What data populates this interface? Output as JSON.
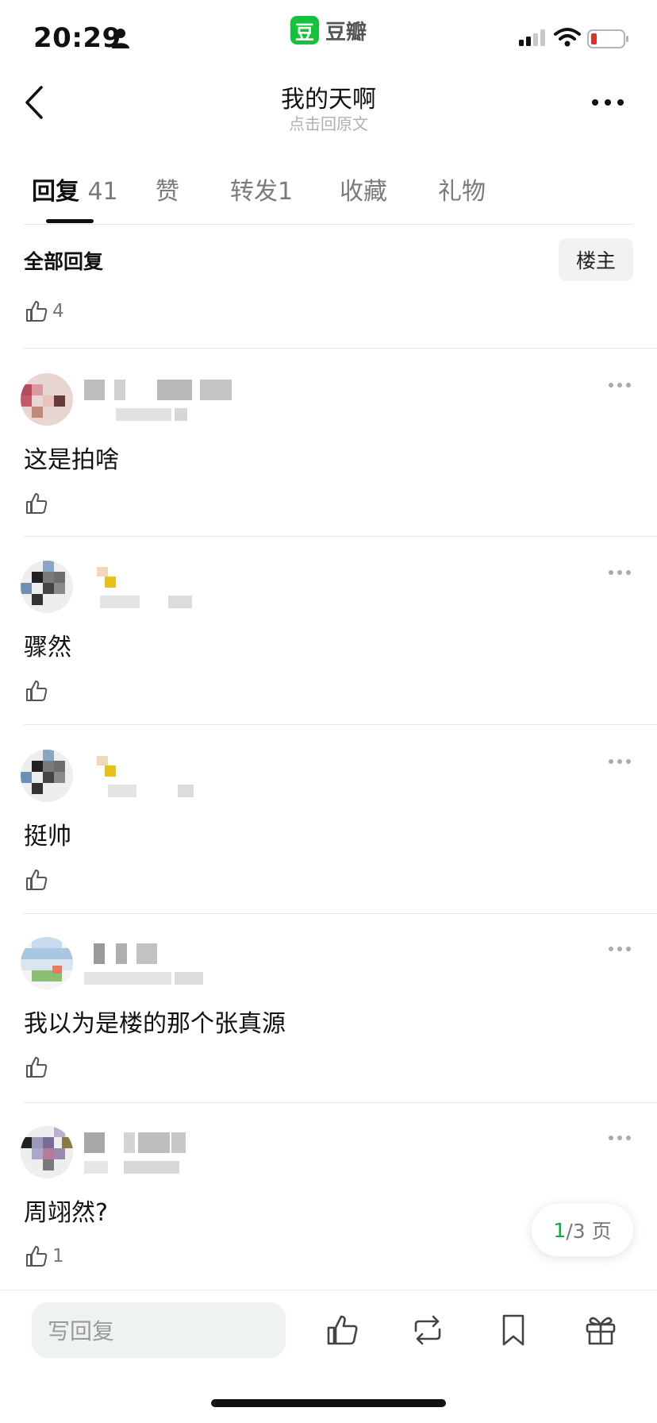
{
  "status_bar": {
    "time": "20:29",
    "app_logo_char": "豆",
    "app_name": "豆瓣"
  },
  "nav": {
    "title": "我的天啊",
    "subtitle": "点击回原文"
  },
  "tabs": [
    {
      "label": "回复",
      "count": "41",
      "active": true
    },
    {
      "label": "赞",
      "count": ""
    },
    {
      "label": "转发",
      "count": "1"
    },
    {
      "label": "收藏",
      "count": ""
    },
    {
      "label": "礼物",
      "count": ""
    }
  ],
  "section": {
    "title": "全部回复",
    "op_button": "楼主",
    "post_likes": "4"
  },
  "comments": [
    {
      "text": "这是拍啥",
      "likes": ""
    },
    {
      "text": "骤然",
      "likes": ""
    },
    {
      "text": "挺帅",
      "likes": ""
    },
    {
      "text": "我以为是楼的那个张真源",
      "likes": ""
    },
    {
      "text": "周翊然?",
      "likes": "1"
    }
  ],
  "pagination": {
    "current": "1",
    "rest": "/3 页"
  },
  "bottom_bar": {
    "reply_placeholder": "写回复"
  },
  "colors": {
    "brand_green": "#13c33a",
    "page_green": "#13a83c"
  },
  "icons": [
    "person-icon",
    "back-icon",
    "more-icon",
    "thumb-up-icon",
    "repost-icon",
    "bookmark-icon",
    "gift-icon",
    "wifi-icon",
    "signal-icon",
    "battery-icon"
  ]
}
